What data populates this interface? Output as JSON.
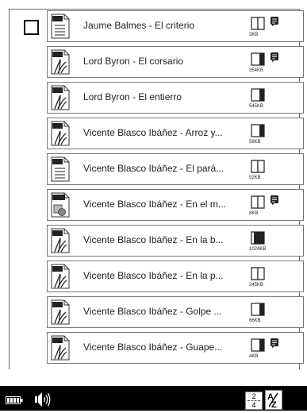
{
  "list": {
    "rows": [
      {
        "title": "Jaume Balmes - El criterio",
        "type": "TXT",
        "status": "open",
        "size": "3KB",
        "note": true
      },
      {
        "title": "Lord Byron - El corsario",
        "type": "PDF",
        "status": "partial",
        "size": "354KB",
        "note": true
      },
      {
        "title": "Lord Byron - El entierro",
        "type": "PDF",
        "status": "partial",
        "size": "545KB",
        "note": false
      },
      {
        "title": "Vicente Blasco Ibáñez - Arroz y...",
        "type": "PDF",
        "status": "partial",
        "size": "58KB",
        "note": false
      },
      {
        "title": "Vicente Blasco Ibáñez - El pará...",
        "type": "TXT",
        "status": "open",
        "size": "52KB",
        "note": false
      },
      {
        "title": "Vicente Blasco Ibáñez - En el m...",
        "type": "JPEG",
        "status": "open",
        "size": "8KB",
        "note": true
      },
      {
        "title": "Vicente Blasco Ibáñez - En la b...",
        "type": "PDF",
        "status": "closed",
        "size": "1024KB",
        "note": false
      },
      {
        "title": "Vicente Blasco Ibáñez - En la p...",
        "type": "PDF",
        "status": "open",
        "size": "245KB",
        "note": false
      },
      {
        "title": "Vicente Blasco Ibáñez - Golpe ...",
        "type": "PDF",
        "status": "partial",
        "size": "66KB",
        "note": false
      },
      {
        "title": "Vicente Blasco Ibáñez - Guape...",
        "type": "PDF",
        "status": "partial",
        "size": "4KB",
        "note": true
      }
    ]
  },
  "status_bar": {
    "page_current": "2",
    "page_total": "4",
    "battery_icon": "battery-icon",
    "speaker_icon": "speaker-icon",
    "sort_icon": "sort-az-icon"
  },
  "colors": {
    "status_bar": "#000000",
    "border": "#777777"
  }
}
